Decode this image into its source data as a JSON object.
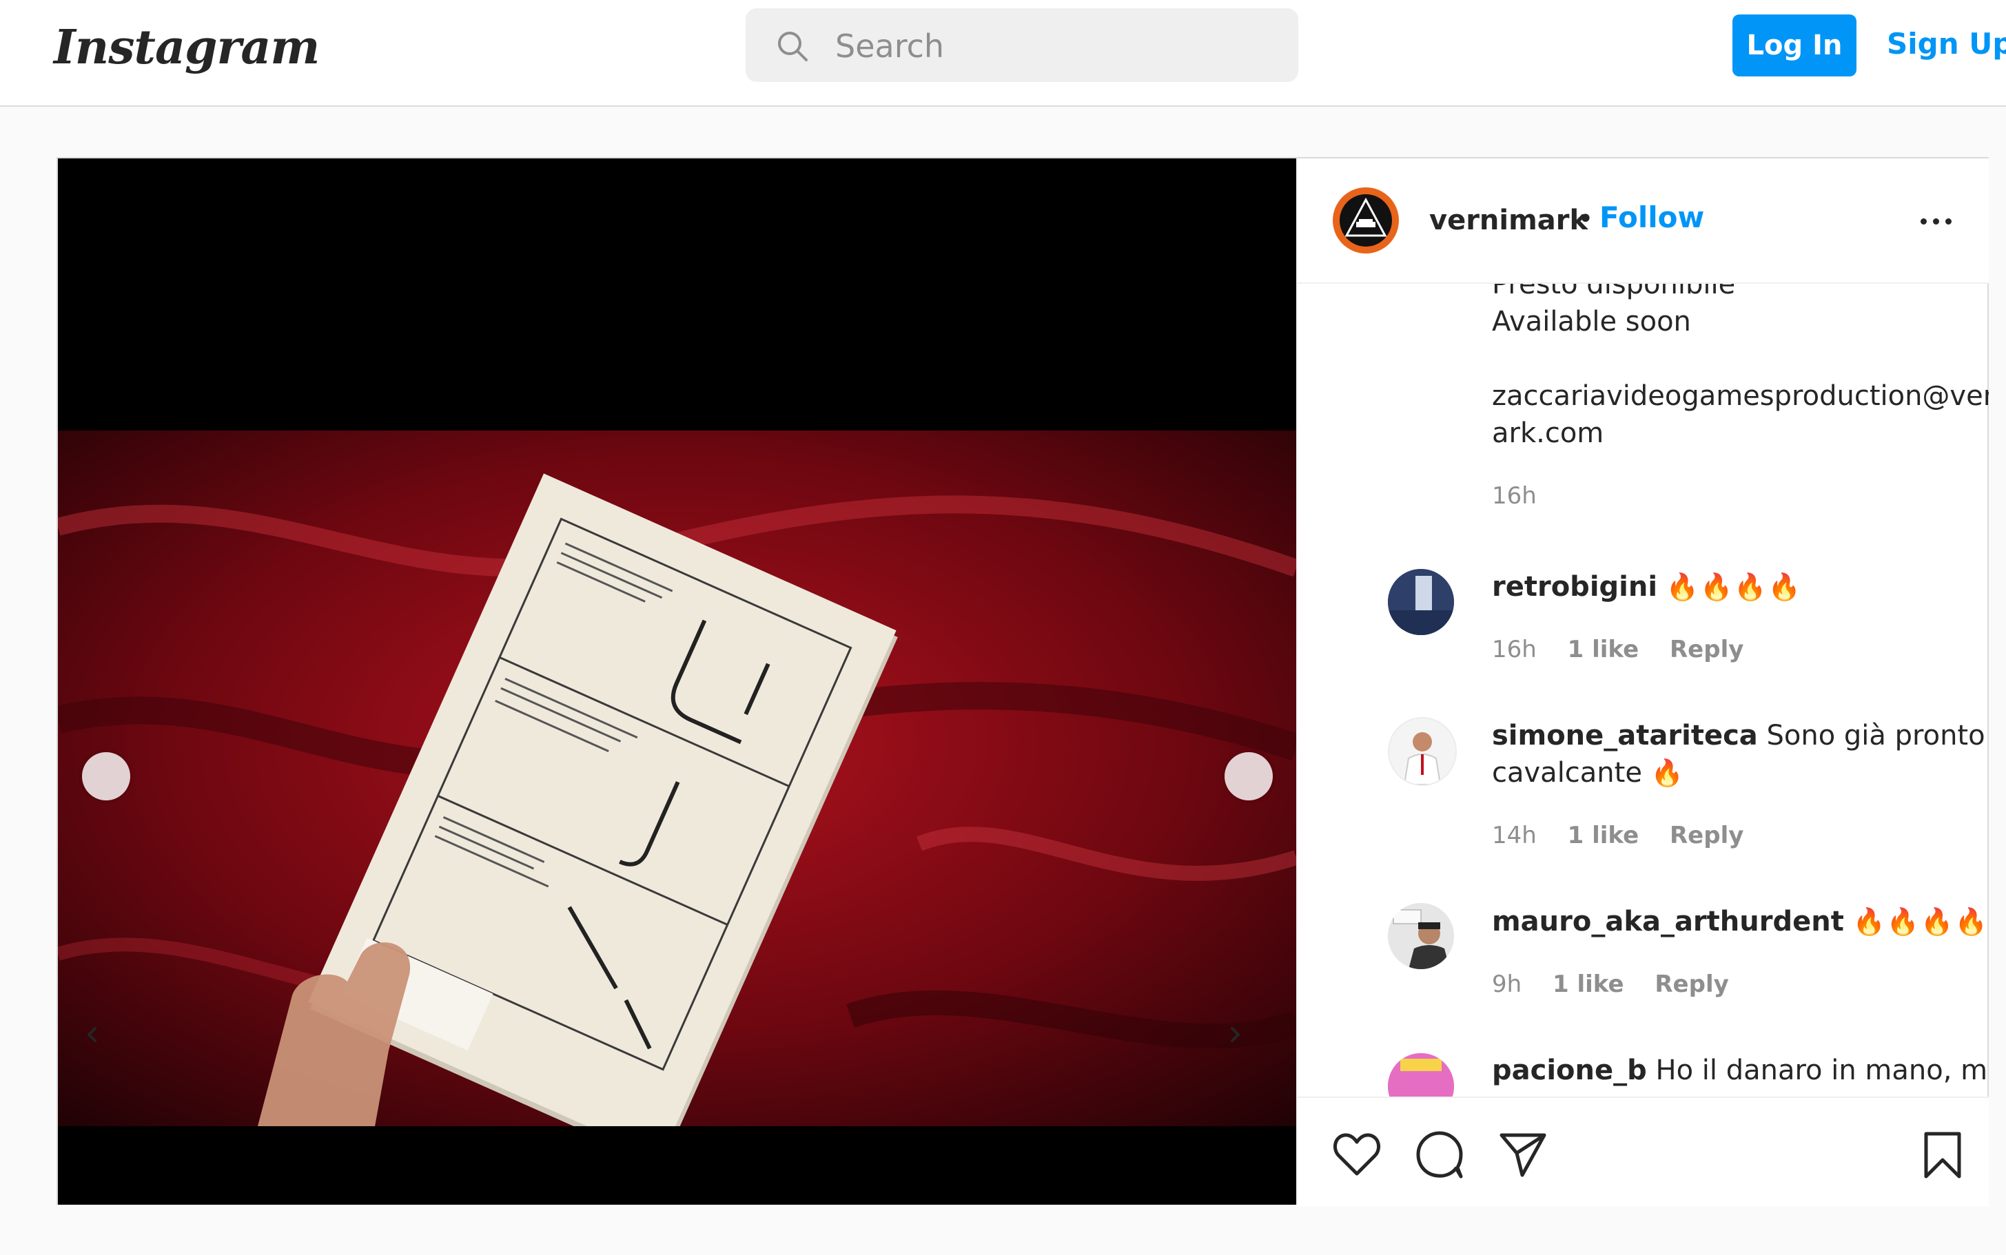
{
  "nav": {
    "logo": "Instagram",
    "search_placeholder": "Search",
    "login_label": "Log In",
    "signup_label": "Sign Up"
  },
  "post": {
    "author": "vernimark",
    "separator": "•",
    "follow_label": "Follow",
    "caption_lines": [
      "Presto disponibile",
      "Available soon"
    ],
    "email_lines": [
      "zaccariavideogamesproduction@vernim",
      "ark.com"
    ],
    "caption_time": "16h"
  },
  "comments": [
    {
      "username": "retrobigini",
      "text": "",
      "emoji": "🔥🔥🔥🔥",
      "time": "16h",
      "likes": "1 like",
      "reply": "Reply"
    },
    {
      "username": "simone_atariteca",
      "text": "Sono già pronto e",
      "text2": "cavalcante",
      "emoji": "🔥",
      "time": "14h",
      "likes": "1 like",
      "reply": "Reply"
    },
    {
      "username": "mauro_aka_arthurdent",
      "text": "",
      "emoji": "🔥🔥🔥🔥",
      "time": "9h",
      "likes": "1 like",
      "reply": "Reply"
    },
    {
      "username": "pacione_b",
      "text": "Ho il danaro in mano, mi dica"
    }
  ],
  "colors": {
    "accent": "#0095f6",
    "text": "#262626",
    "muted": "#8e8e8e",
    "border": "#dbdbdb",
    "velvet": "#8a0a14"
  },
  "icons": {
    "search": "search-icon",
    "prev": "chevron-left-icon",
    "next": "chevron-right-icon",
    "more": "more-horizontal-icon",
    "like": "heart-icon",
    "comment": "comment-icon",
    "share": "send-icon",
    "save": "bookmark-icon"
  }
}
